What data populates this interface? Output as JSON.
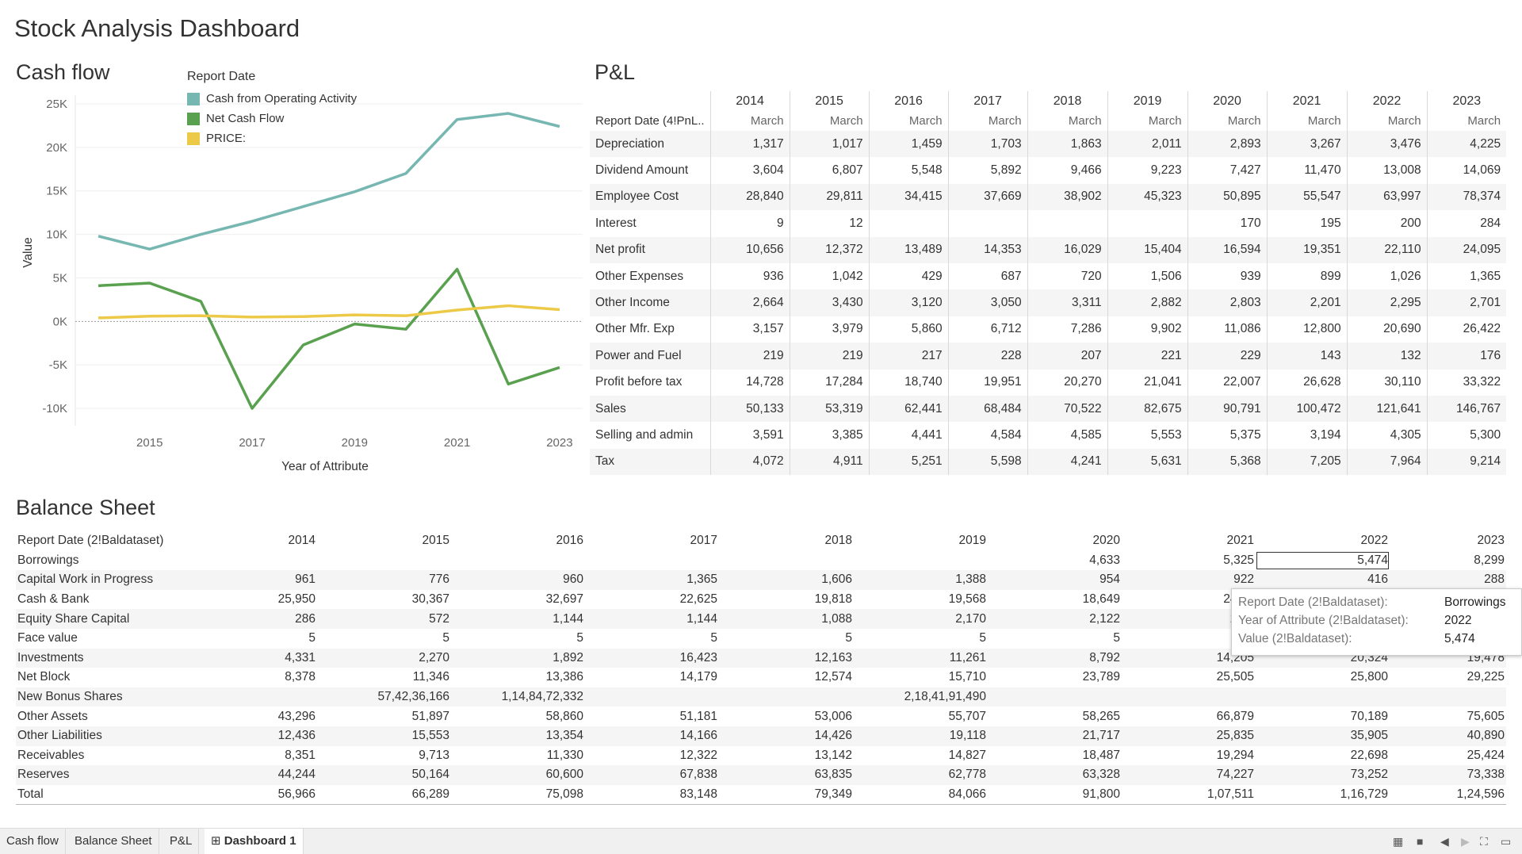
{
  "dashboard_title": "Stock Analysis Dashboard",
  "cash_flow": {
    "section_title": "Cash flow",
    "legend_title": "Report Date",
    "legend": [
      {
        "name": "Cash from Operating Activity",
        "color": "#76b7b2"
      },
      {
        "name": "Net Cash Flow",
        "color": "#59a14f"
      },
      {
        "name": "PRICE:",
        "color": "#edc948"
      }
    ],
    "ylabel": "Value",
    "xlabel": "Year of Attribute"
  },
  "chart_data": {
    "type": "line",
    "title": "Cash flow",
    "xlabel": "Year of Attribute",
    "ylabel": "Value",
    "x": [
      2014,
      2015,
      2016,
      2017,
      2018,
      2019,
      2020,
      2021,
      2022,
      2023
    ],
    "x_ticks": [
      "2015",
      "2017",
      "2019",
      "2021",
      "2023"
    ],
    "y_ticks": [
      "25K",
      "20K",
      "15K",
      "10K",
      "5K",
      "0K",
      "-5K",
      "-10K"
    ],
    "ylim": [
      -12000,
      26000
    ],
    "series": [
      {
        "name": "Cash from Operating Activity",
        "color": "#76b7b2",
        "values": [
          9800,
          8300,
          10000,
          11500,
          13200,
          14900,
          17000,
          23200,
          23900,
          22400
        ]
      },
      {
        "name": "Net Cash Flow",
        "color": "#59a14f",
        "values": [
          4100,
          4400,
          2300,
          -10000,
          -2700,
          -300,
          -900,
          6000,
          -7200,
          -5300
        ]
      },
      {
        "name": "PRICE:",
        "color": "#edc948",
        "values": [
          400,
          600,
          650,
          500,
          550,
          750,
          650,
          1300,
          1800,
          1350
        ]
      }
    ],
    "zero_line": true,
    "grid": true,
    "legend_position": "top"
  },
  "pl": {
    "section_title": "P&L",
    "row_header_label": "Report Date (4!PnL..",
    "years": [
      "2014",
      "2015",
      "2016",
      "2017",
      "2018",
      "2019",
      "2020",
      "2021",
      "2022",
      "2023"
    ],
    "months": [
      "March",
      "March",
      "March",
      "March",
      "March",
      "March",
      "March",
      "March",
      "March",
      "March"
    ],
    "rows": [
      {
        "label": "Depreciation",
        "values": [
          "1,317",
          "1,017",
          "1,459",
          "1,703",
          "1,863",
          "2,011",
          "2,893",
          "3,267",
          "3,476",
          "4,225"
        ]
      },
      {
        "label": "Dividend Amount",
        "values": [
          "3,604",
          "6,807",
          "5,548",
          "5,892",
          "9,466",
          "9,223",
          "7,427",
          "11,470",
          "13,008",
          "14,069"
        ]
      },
      {
        "label": "Employee Cost",
        "values": [
          "28,840",
          "29,811",
          "34,415",
          "37,669",
          "38,902",
          "45,323",
          "50,895",
          "55,547",
          "63,997",
          "78,374"
        ]
      },
      {
        "label": "Interest",
        "values": [
          "9",
          "12",
          "",
          "",
          "",
          "",
          "170",
          "195",
          "200",
          "284"
        ]
      },
      {
        "label": "Net profit",
        "values": [
          "10,656",
          "12,372",
          "13,489",
          "14,353",
          "16,029",
          "15,404",
          "16,594",
          "19,351",
          "22,110",
          "24,095"
        ]
      },
      {
        "label": "Other Expenses",
        "values": [
          "936",
          "1,042",
          "429",
          "687",
          "720",
          "1,506",
          "939",
          "899",
          "1,026",
          "1,365"
        ]
      },
      {
        "label": "Other Income",
        "values": [
          "2,664",
          "3,430",
          "3,120",
          "3,050",
          "3,311",
          "2,882",
          "2,803",
          "2,201",
          "2,295",
          "2,701"
        ]
      },
      {
        "label": "Other Mfr. Exp",
        "values": [
          "3,157",
          "3,979",
          "5,860",
          "6,712",
          "7,286",
          "9,902",
          "11,086",
          "12,800",
          "20,690",
          "26,422"
        ]
      },
      {
        "label": "Power and Fuel",
        "values": [
          "219",
          "219",
          "217",
          "228",
          "207",
          "221",
          "229",
          "143",
          "132",
          "176"
        ]
      },
      {
        "label": "Profit before tax",
        "values": [
          "14,728",
          "17,284",
          "18,740",
          "19,951",
          "20,270",
          "21,041",
          "22,007",
          "26,628",
          "30,110",
          "33,322"
        ]
      },
      {
        "label": "Sales",
        "values": [
          "50,133",
          "53,319",
          "62,441",
          "68,484",
          "70,522",
          "82,675",
          "90,791",
          "100,472",
          "121,641",
          "146,767"
        ]
      },
      {
        "label": "Selling and admin",
        "values": [
          "3,591",
          "3,385",
          "4,441",
          "4,584",
          "4,585",
          "5,553",
          "5,375",
          "3,194",
          "4,305",
          "5,300"
        ]
      },
      {
        "label": "Tax",
        "values": [
          "4,072",
          "4,911",
          "5,251",
          "5,598",
          "4,241",
          "5,631",
          "5,368",
          "7,205",
          "7,964",
          "9,214"
        ]
      }
    ]
  },
  "balance_sheet": {
    "section_title": "Balance Sheet",
    "row_header_label": "Report Date (2!Baldataset)",
    "years": [
      "2014",
      "2015",
      "2016",
      "2017",
      "2018",
      "2019",
      "2020",
      "2021",
      "2022",
      "2023"
    ],
    "rows": [
      {
        "label": "Borrowings",
        "values": [
          "",
          "",
          "",
          "",
          "",
          "",
          "4,633",
          "5,325",
          "5,474",
          "8,299"
        ]
      },
      {
        "label": "Capital Work in Progress",
        "values": [
          "961",
          "776",
          "960",
          "1,365",
          "1,606",
          "1,388",
          "954",
          "922",
          "416",
          "288"
        ]
      },
      {
        "label": "Cash & Bank",
        "values": [
          "25,950",
          "30,367",
          "32,697",
          "22,625",
          "19,818",
          "19,568",
          "18,649",
          "24,71",
          "",
          ""
        ]
      },
      {
        "label": "Equity Share Capital",
        "values": [
          "286",
          "572",
          "1,144",
          "1,144",
          "1,088",
          "2,170",
          "2,122",
          "2,12",
          "",
          ""
        ]
      },
      {
        "label": "Face value",
        "values": [
          "5",
          "5",
          "5",
          "5",
          "5",
          "5",
          "5",
          "",
          "",
          ""
        ]
      },
      {
        "label": "Investments",
        "values": [
          "4,331",
          "2,270",
          "1,892",
          "16,423",
          "12,163",
          "11,261",
          "8,792",
          "14,205",
          "20,324",
          "19,478"
        ]
      },
      {
        "label": "Net Block",
        "values": [
          "8,378",
          "11,346",
          "13,386",
          "14,179",
          "12,574",
          "15,710",
          "23,789",
          "25,505",
          "25,800",
          "29,225"
        ]
      },
      {
        "label": "New Bonus Shares",
        "values": [
          "",
          "57,42,36,166",
          "1,14,84,72,332",
          "",
          "",
          "2,18,41,91,490",
          "",
          "",
          "",
          ""
        ]
      },
      {
        "label": "Other Assets",
        "values": [
          "43,296",
          "51,897",
          "58,860",
          "51,181",
          "53,006",
          "55,707",
          "58,265",
          "66,879",
          "70,189",
          "75,605"
        ]
      },
      {
        "label": "Other Liabilities",
        "values": [
          "12,436",
          "15,553",
          "13,354",
          "14,166",
          "14,426",
          "19,118",
          "21,717",
          "25,835",
          "35,905",
          "40,890"
        ]
      },
      {
        "label": "Receivables",
        "values": [
          "8,351",
          "9,713",
          "11,330",
          "12,322",
          "13,142",
          "14,827",
          "18,487",
          "19,294",
          "22,698",
          "25,424"
        ]
      },
      {
        "label": "Reserves",
        "values": [
          "44,244",
          "50,164",
          "60,600",
          "67,838",
          "63,835",
          "62,778",
          "63,328",
          "74,227",
          "73,252",
          "73,338"
        ]
      },
      {
        "label": "Total",
        "values": [
          "56,966",
          "66,289",
          "75,098",
          "83,148",
          "79,349",
          "84,066",
          "91,800",
          "1,07,511",
          "1,16,729",
          "1,24,596"
        ]
      }
    ]
  },
  "tooltip": {
    "rows": [
      {
        "key": "Report Date (2!Baldataset):",
        "value": "Borrowings"
      },
      {
        "key": "Year of Attribute (2!Baldataset):",
        "value": "2022"
      },
      {
        "key": "Value (2!Baldataset):",
        "value": "5,474"
      }
    ]
  },
  "tabs": [
    {
      "label": "Cash flow",
      "active": false
    },
    {
      "label": "Balance Sheet",
      "active": false
    },
    {
      "label": "P&L",
      "active": false
    },
    {
      "label": "Dashboard 1",
      "active": true
    }
  ]
}
